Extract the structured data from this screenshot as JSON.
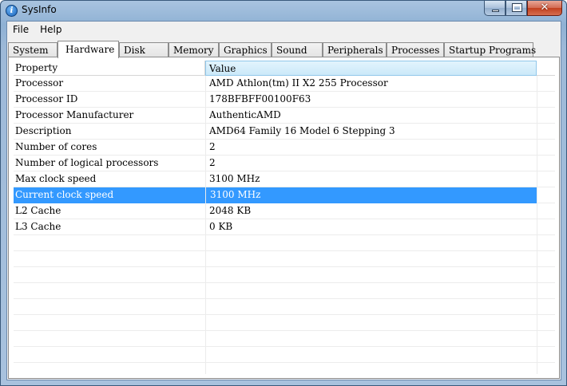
{
  "window": {
    "title": "SysInfo",
    "icon": "i"
  },
  "caption_buttons": {
    "close_glyph": "✕"
  },
  "menu": {
    "items": [
      "File",
      "Help"
    ]
  },
  "tabs": [
    {
      "label": "System",
      "active": false
    },
    {
      "label": "Hardware",
      "active": true
    },
    {
      "label": "Disk",
      "active": false
    },
    {
      "label": "Memory",
      "active": false
    },
    {
      "label": "Graphics",
      "active": false
    },
    {
      "label": "Sound",
      "active": false
    },
    {
      "label": "Peripherals",
      "active": false
    },
    {
      "label": "Processes",
      "active": false
    },
    {
      "label": "Startup Programs",
      "active": false
    }
  ],
  "grid": {
    "columns": [
      "Property",
      "Value"
    ],
    "rows": [
      {
        "property": "Processor",
        "value": "AMD Athlon(tm) II X2 255 Processor"
      },
      {
        "property": "Processor ID",
        "value": "178BFBFF00100F63"
      },
      {
        "property": "Processor Manufacturer",
        "value": "AuthenticAMD"
      },
      {
        "property": "Description",
        "value": "AMD64 Family 16 Model 6 Stepping 3"
      },
      {
        "property": "Number of cores",
        "value": "2"
      },
      {
        "property": "Number of logical processors",
        "value": "2"
      },
      {
        "property": "Max clock speed",
        "value": "3100 MHz"
      },
      {
        "property": "Current clock speed",
        "value": "3100 MHz",
        "selected": true
      },
      {
        "property": "L2 Cache",
        "value": "2048 KB"
      },
      {
        "property": "L3 Cache",
        "value": "0 KB"
      }
    ]
  },
  "colors": {
    "selection": "#3399ff",
    "header_value_bg": "#cbe9f9",
    "frame": "#a9c4e0"
  }
}
